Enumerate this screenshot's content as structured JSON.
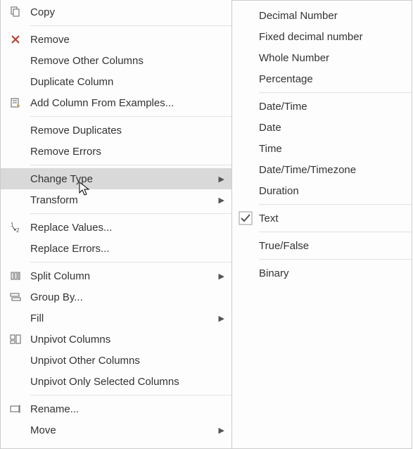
{
  "mainMenu": {
    "items": [
      {
        "id": "copy",
        "label": "Copy",
        "icon": "copy-icon"
      },
      {
        "sep": true
      },
      {
        "id": "remove",
        "label": "Remove",
        "icon": "remove-icon"
      },
      {
        "id": "remove-other",
        "label": "Remove Other Columns"
      },
      {
        "id": "duplicate",
        "label": "Duplicate Column"
      },
      {
        "id": "add-from-ex",
        "label": "Add Column From Examples...",
        "icon": "examples-icon"
      },
      {
        "sep": true
      },
      {
        "id": "remove-dup",
        "label": "Remove Duplicates"
      },
      {
        "id": "remove-err",
        "label": "Remove Errors"
      },
      {
        "sep": true
      },
      {
        "id": "change-type",
        "label": "Change Type",
        "submenu": true,
        "highlight": true
      },
      {
        "id": "transform",
        "label": "Transform",
        "submenu": true
      },
      {
        "sep": true
      },
      {
        "id": "replace-vals",
        "label": "Replace Values...",
        "icon": "replace-icon"
      },
      {
        "id": "replace-err",
        "label": "Replace Errors..."
      },
      {
        "sep": true
      },
      {
        "id": "split",
        "label": "Split Column",
        "icon": "split-icon",
        "submenu": true
      },
      {
        "id": "group",
        "label": "Group By...",
        "icon": "group-icon"
      },
      {
        "id": "fill",
        "label": "Fill",
        "submenu": true
      },
      {
        "id": "unpivot",
        "label": "Unpivot Columns",
        "icon": "unpivot-icon"
      },
      {
        "id": "unpivot-other",
        "label": "Unpivot Other Columns"
      },
      {
        "id": "unpivot-sel",
        "label": "Unpivot Only Selected Columns"
      },
      {
        "sep": true
      },
      {
        "id": "rename",
        "label": "Rename...",
        "icon": "rename-icon"
      },
      {
        "id": "move",
        "label": "Move",
        "submenu": true
      }
    ]
  },
  "subMenu": {
    "items": [
      {
        "id": "decimal",
        "label": "Decimal Number"
      },
      {
        "id": "fixed-dec",
        "label": "Fixed decimal number"
      },
      {
        "id": "whole",
        "label": "Whole Number"
      },
      {
        "id": "percent",
        "label": "Percentage"
      },
      {
        "sep": true
      },
      {
        "id": "datetime",
        "label": "Date/Time"
      },
      {
        "id": "date",
        "label": "Date"
      },
      {
        "id": "time",
        "label": "Time"
      },
      {
        "id": "dtz",
        "label": "Date/Time/Timezone"
      },
      {
        "id": "duration",
        "label": "Duration"
      },
      {
        "sep": true
      },
      {
        "id": "text",
        "label": "Text",
        "checked": true
      },
      {
        "sep": true
      },
      {
        "id": "truefalse",
        "label": "True/False"
      },
      {
        "sep": true
      },
      {
        "id": "binary",
        "label": "Binary"
      }
    ]
  }
}
